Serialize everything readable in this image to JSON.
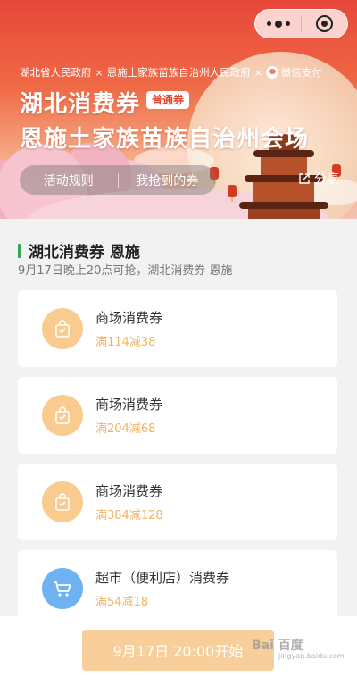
{
  "capsule": {
    "more_icon": "more-dots-icon",
    "close_icon": "target-close-icon"
  },
  "banner": {
    "sponsor_1": "湖北省人民政府",
    "sponsor_2": "恩施土家族苗族自治州人民政府",
    "sponsor_3": "微信支付",
    "separator": "×",
    "title_line1": "湖北消费券",
    "badge": "普通券",
    "title_line2": "恩施土家族苗族自治州会场",
    "rules_label": "活动规则",
    "my_coupons_label": "我抢到的券",
    "share_label": "分享"
  },
  "section": {
    "title": "湖北消费券 恩施",
    "subtitle": "9月17日晚上20点可抢，湖北消费券 恩施"
  },
  "coupons": [
    {
      "name": "商场消费券",
      "condition": "满114减38",
      "icon": "shopping-bag-icon"
    },
    {
      "name": "商场消费券",
      "condition": "满204减68",
      "icon": "shopping-bag-icon"
    },
    {
      "name": "商场消费券",
      "condition": "满384减128",
      "icon": "shopping-bag-icon"
    },
    {
      "name": "超市（便利店）消费券",
      "condition": "满54减18",
      "icon": "shopping-cart-icon"
    }
  ],
  "footer": {
    "start_label": "9月17日 20:00开始",
    "watermark": "Bai 百度",
    "watermark_sub": "jingyan.baidu.com"
  },
  "colors": {
    "accent_green": "#2fa85a",
    "coupon_condition": "#f2b25f",
    "bag_icon_bg": "#f9cb8f",
    "cart_icon_bg": "#6fb2f2",
    "start_button": "#f8cf9b"
  }
}
